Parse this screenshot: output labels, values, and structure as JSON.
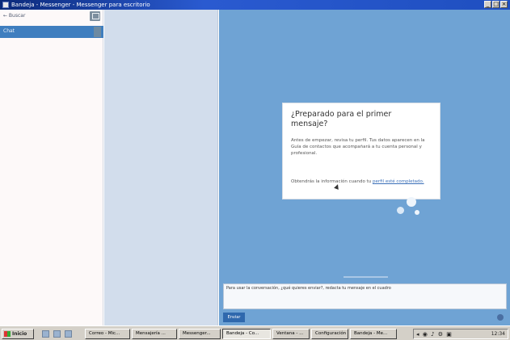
{
  "window": {
    "title": "Bandeja - Messenger - Messenger para escritorio",
    "minimize_label": "_",
    "maximize_label": "□",
    "close_label": "×"
  },
  "sidebar": {
    "search_label": "← Buscar",
    "active_item_label": "Chat"
  },
  "card": {
    "heading": "¿Preparado para el primer mensaje?",
    "body": "Antes de empezar, revisa tu perfil. Tus datos aparecen en la Guía de contactos que acompañará a tu cuenta personal y profesional.",
    "footer_text": "Obtendrás la información cuando tu",
    "footer_link": "perfil esté completado."
  },
  "reply": {
    "placeholder": "Para usar la conversación, ¿qué quieres enviar?, redacta tu mensaje en el cuadro",
    "send_label": "Enviar"
  },
  "taskbar": {
    "start_label": "Inicio",
    "tasks": [
      "Correo - Mic...",
      "Mensajería ...",
      "Messenger...",
      "Bandeja - Co...",
      "Ventana - ...",
      "Configuración",
      "Bandeja - Me..."
    ],
    "tray_icons": "◂ ◉ ♪ ⚙ ▣",
    "clock": "12:34"
  }
}
